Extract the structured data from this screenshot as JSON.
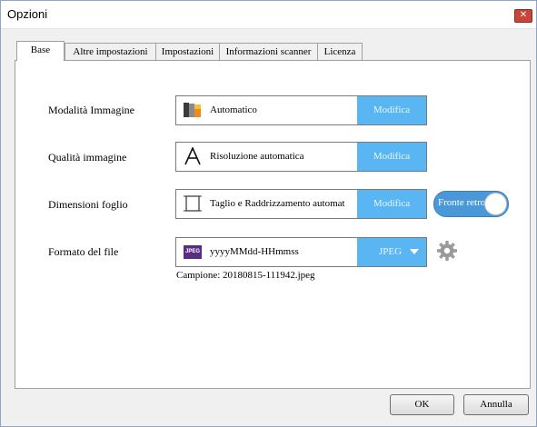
{
  "window": {
    "title": "Opzioni",
    "close_icon": "close-icon"
  },
  "tabs": [
    {
      "label": "Base",
      "active": true
    },
    {
      "label": "Altre impostazioni",
      "active": false
    },
    {
      "label": "Impostazioni",
      "active": false
    },
    {
      "label": "Informazioni scanner",
      "active": false
    },
    {
      "label": "Licenza",
      "active": false
    }
  ],
  "settings": {
    "image_mode": {
      "label": "Modalità Immagine",
      "value": "Automatico",
      "button": "Modifica",
      "icon": "color-mode-icon"
    },
    "image_quality": {
      "label": "Qualità immagine",
      "value": "Risoluzione automatica",
      "button": "Modifica",
      "icon": "font-a-icon"
    },
    "page_size": {
      "label": "Dimensioni foglio",
      "value": "Taglio e Raddrizzamento automat",
      "button": "Modifica",
      "icon": "page-crop-icon"
    },
    "duplex_toggle": {
      "label": "Fronte retro",
      "on": true,
      "color": "#4b98d8"
    },
    "file_format": {
      "label": "Formato del file",
      "value": "yyyyMMdd-HHmmss",
      "format": "JPEG",
      "badge": "JPEG",
      "icon": "jpeg-icon",
      "settings_icon": "gear-icon"
    },
    "sample": "Campione: 20180815-111942.jpeg"
  },
  "colors": {
    "accent_button": "#5ab6f2",
    "jpeg_badge": "#5a2d84"
  },
  "buttons": {
    "ok": "OK",
    "cancel": "Annulla"
  }
}
